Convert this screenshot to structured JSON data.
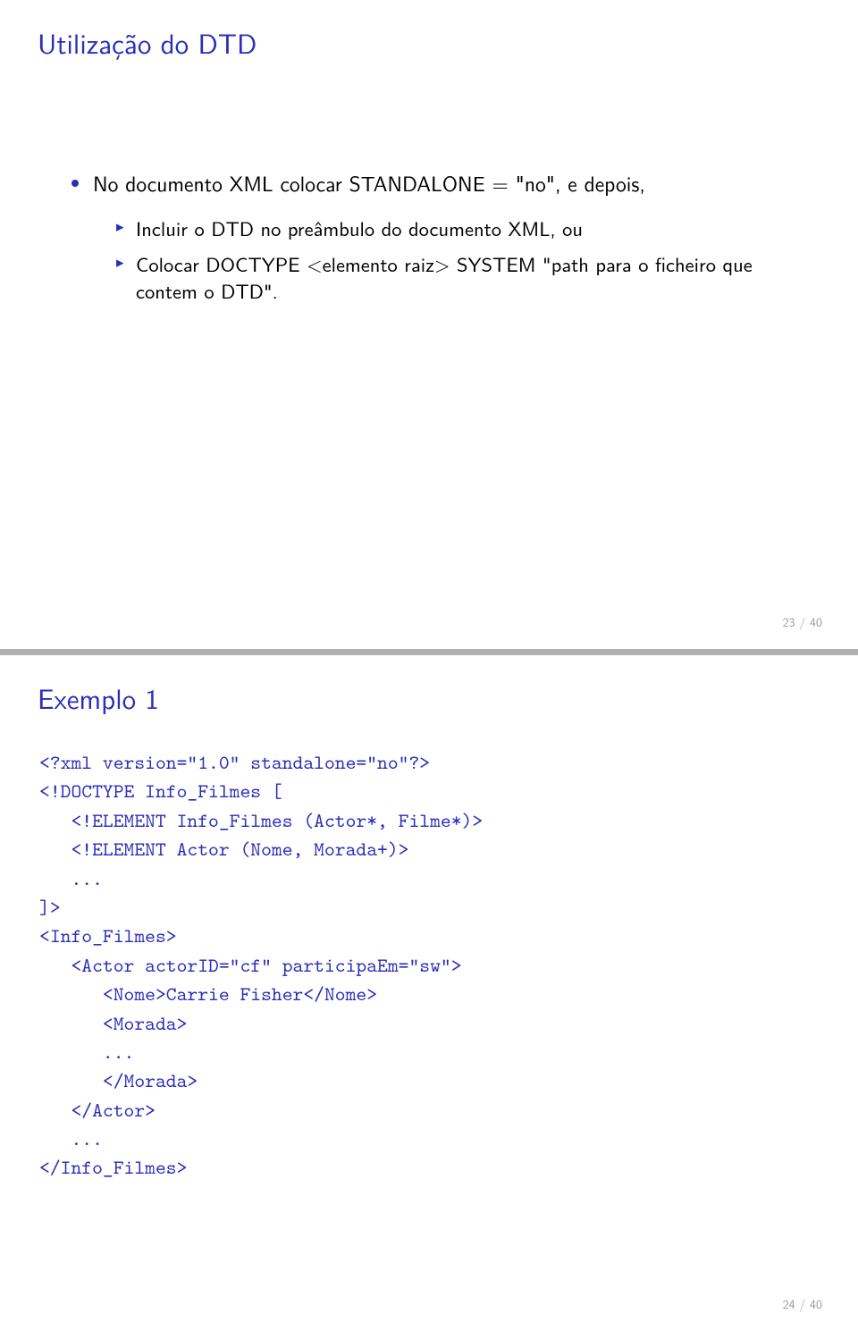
{
  "slide1": {
    "title": "Utilização do DTD",
    "bullet1": "No documento XML colocar STANDALONE = \"no\", e depois,",
    "sub1": "Incluir o DTD no preâmbulo do documento XML, ou",
    "sub2": "Colocar DOCTYPE <elemento raiz> SYSTEM \"path para o ficheiro que contem o DTD\".",
    "page": "23 / 40"
  },
  "slide2": {
    "title": "Exemplo 1",
    "code": "<?xml version=\"1.0\" standalone=\"no\"?>\n<!DOCTYPE Info_Filmes [\n   <!ELEMENT Info_Filmes (Actor*, Filme*)>\n   <!ELEMENT Actor (Nome, Morada+)>\n   ...\n]>\n<Info_Filmes>\n   <Actor actorID=\"cf\" participaEm=\"sw\">\n      <Nome>Carrie Fisher</Nome>\n      <Morada>\n      ...\n      </Morada>\n   </Actor>\n   ...\n</Info_Filmes>",
    "page": "24 / 40"
  }
}
